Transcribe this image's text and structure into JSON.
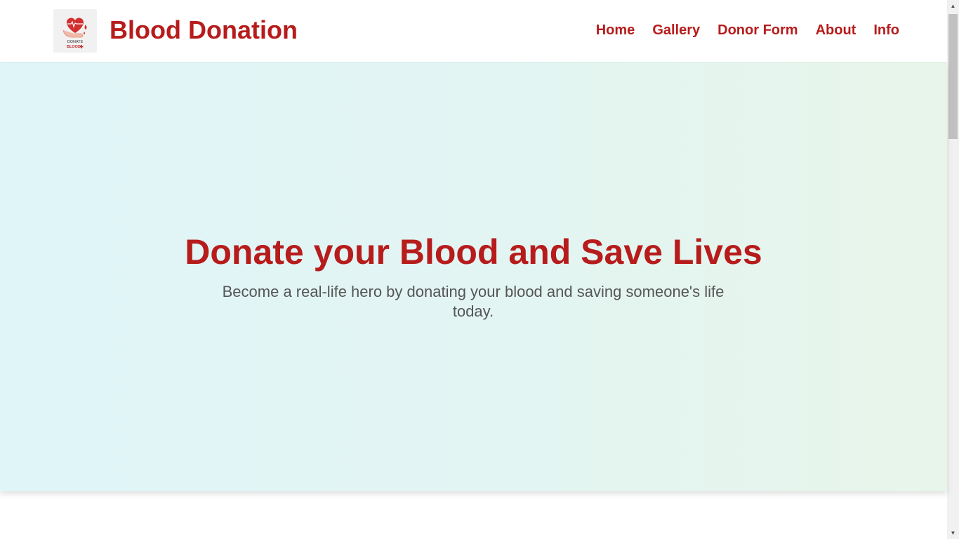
{
  "header": {
    "site_title": "Blood Donation",
    "logo": {
      "icon": "heart-blood-drop-logo",
      "text_line1": "DONATE",
      "text_line2": "BLOOD"
    },
    "nav": [
      {
        "label": "Home"
      },
      {
        "label": "Gallery"
      },
      {
        "label": "Donor Form"
      },
      {
        "label": "About"
      },
      {
        "label": "Info"
      }
    ]
  },
  "hero": {
    "title": "Donate your Blood and Save Lives",
    "subtitle": "Become a real-life hero by donating your blood and saving someone's life today."
  },
  "colors": {
    "brand": "#b71c1c",
    "subtitle": "#555555",
    "hero_gradient_start": "#e0f5f8",
    "hero_gradient_end": "#e8f5ea"
  },
  "scrollbar": {
    "up_icon": "triangle-up-icon",
    "down_icon": "triangle-down-icon"
  }
}
